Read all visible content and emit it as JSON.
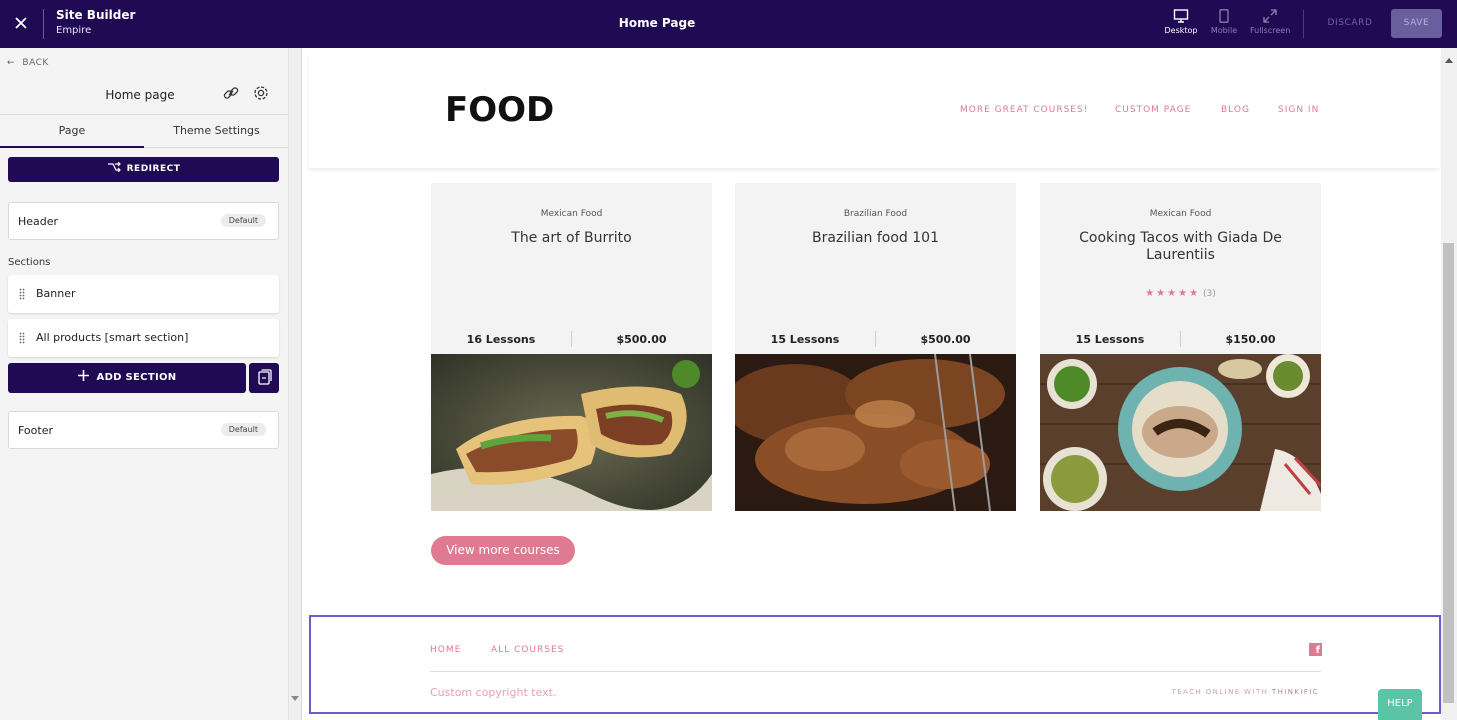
{
  "topbar": {
    "app_name": "Site Builder",
    "theme_name": "Empire",
    "page_title": "Home Page",
    "views": [
      {
        "label": "Desktop",
        "active": true
      },
      {
        "label": "Mobile",
        "active": false
      },
      {
        "label": "Fullscreen",
        "active": false
      }
    ],
    "discard_label": "DISCARD",
    "save_label": "SAVE"
  },
  "sidebar": {
    "back_label": "BACK",
    "title": "Home page",
    "tabs": [
      {
        "label": "Page",
        "active": true
      },
      {
        "label": "Theme Settings",
        "active": false
      }
    ],
    "redirect_label": "REDIRECT",
    "header": {
      "label": "Header",
      "badge": "Default"
    },
    "sections_label": "Sections",
    "sections": [
      {
        "label": "Banner"
      },
      {
        "label": "All products [smart section]"
      }
    ],
    "add_section_label": "ADD SECTION",
    "footer": {
      "label": "Footer",
      "badge": "Default"
    }
  },
  "site": {
    "logo_text": "FOOD",
    "nav": [
      "MORE GREAT COURSES!",
      "CUSTOM PAGE",
      "BLOG",
      "SIGN IN"
    ],
    "courses": [
      {
        "category": "Mexican Food",
        "name": "The art of Burrito",
        "lessons": "16 Lessons",
        "price": "$500.00",
        "rating": null,
        "rating_count": null
      },
      {
        "category": "Brazilian Food",
        "name": "Brazilian food 101",
        "lessons": "15 Lessons",
        "price": "$500.00",
        "rating": null,
        "rating_count": null
      },
      {
        "category": "Mexican Food",
        "name": "Cooking Tacos with Giada De Laurentiis",
        "lessons": "15 Lessons",
        "price": "$150.00",
        "rating": 5,
        "rating_count": "(3)"
      }
    ],
    "view_more_label": "View more courses",
    "footer": {
      "links": [
        "HOME",
        "ALL COURSES"
      ],
      "copyright": "Custom copyright text.",
      "powered_prefix": "TEACH ONLINE WITH ",
      "powered_brand": "THINKIFIC"
    }
  },
  "help_label": "HELP",
  "colors": {
    "topbar_bg": "#1f0a53",
    "accent_pink": "#e07a93",
    "footer_selection": "#6b5bd1",
    "help_bg": "#59c4a6"
  }
}
